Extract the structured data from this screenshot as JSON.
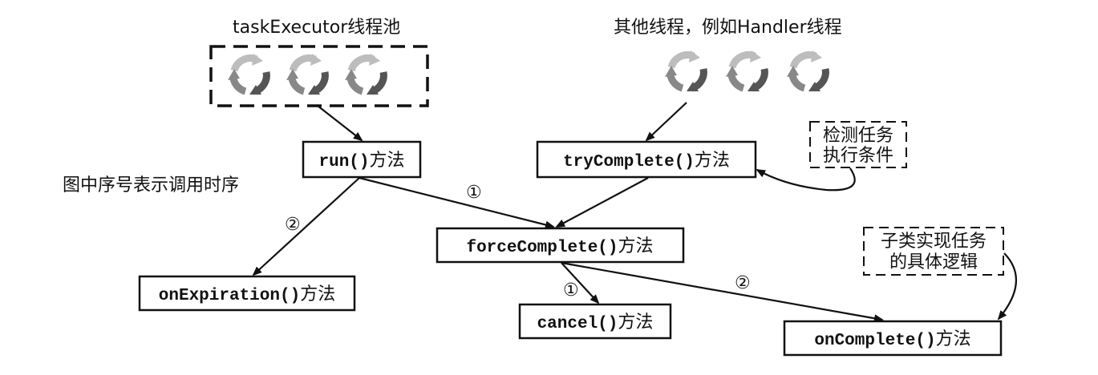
{
  "pool_label": "taskExecutor线程池",
  "other_threads_label": "其他线程，例如Handler线程",
  "legend_note": "图中序号表示调用时序",
  "method_suffix": "方法",
  "methods": {
    "run": "run()",
    "try_complete": "tryComplete()",
    "force_complete": "forceComplete()",
    "on_expiration": "onExpiration()",
    "cancel": "cancel()",
    "on_complete": "onComplete()"
  },
  "note_check": [
    "检测任务",
    "执行条件"
  ],
  "note_subclass": [
    "子类实现任务",
    "的具体逻辑"
  ],
  "order_marks": {
    "run_to_force": "①",
    "run_to_expiration": "②",
    "force_to_cancel": "①",
    "force_to_complete": "②"
  },
  "colors": {
    "line": "#111111",
    "gear_dark": "#555555",
    "gear_light": "#bdbdbd"
  },
  "icons": [
    "refresh-cycle-icon"
  ]
}
